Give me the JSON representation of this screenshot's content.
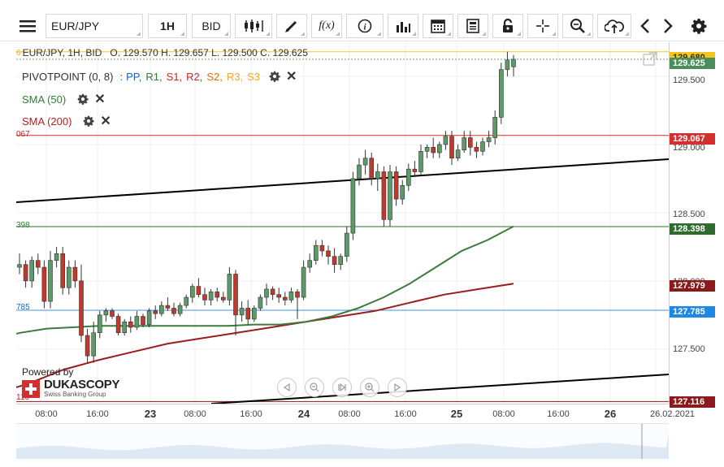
{
  "toolbar": {
    "symbol": "EUR/JPY",
    "period": "1H",
    "price_type": "BID",
    "icons": [
      "menu-icon",
      "candles-icon",
      "draw-icon",
      "function-icon",
      "info-icon",
      "volume-icon",
      "calendar-icon",
      "report-icon",
      "lock-icon",
      "crosshair-icon",
      "zoom-icon",
      "cloud-upload-icon",
      "arrow-left-icon",
      "arrow-right-icon",
      "gear-icon"
    ],
    "fx_label": "f(x)"
  },
  "header": {
    "ohlc": "EUR/JPY, 1H, BID   O. 129.570 H. 129.657 L. 129.500 C. 129.625",
    "left_digit": "6"
  },
  "legend": {
    "pivot": {
      "label": "PIVOTPOINT (0, 8)",
      "sep": ":",
      "items": [
        {
          "text": "PP,",
          "color": "#1565c0"
        },
        {
          "text": "R1,",
          "color": "#2e7d32"
        },
        {
          "text": "S1,",
          "color": "#c62828"
        },
        {
          "text": "R2,",
          "color": "#c62828"
        },
        {
          "text": "S2,",
          "color": "#ef6c00"
        },
        {
          "text": "R3,",
          "color": "#f9a825"
        },
        {
          "text": "S3",
          "color": "#f9a825"
        }
      ]
    },
    "sma50": {
      "label": "SMA (50)",
      "color": "#2e7d32"
    },
    "sma200": {
      "label": "SMA (200)",
      "color": "#b71c1c"
    }
  },
  "left_labels": [
    {
      "text": "067",
      "color": "#c62828"
    },
    {
      "text": "398",
      "color": "#2e7d32"
    },
    {
      "text": "785",
      "color": "#1565c0"
    },
    {
      "text": "116",
      "color": "#b71c1c"
    }
  ],
  "price_axis": {
    "labels": [
      "129.500",
      "129.000",
      "128.500",
      "128.000",
      "127.500"
    ],
    "tags": [
      {
        "text": "129.680",
        "bg": "#f5c518",
        "fg": "#333"
      },
      {
        "text": "129.625",
        "bg": "#4a8f5a",
        "fg": "#fff"
      },
      {
        "text": "129.067",
        "bg": "#d32f2f",
        "fg": "#fff"
      },
      {
        "text": "128.398",
        "bg": "#2e6b2e",
        "fg": "#fff"
      },
      {
        "text": "127.979",
        "bg": "#8b1a1a",
        "fg": "#fff"
      },
      {
        "text": "127.785",
        "bg": "#1e88e5",
        "fg": "#fff"
      },
      {
        "text": "127.116",
        "bg": "#8b1a1a",
        "fg": "#fff"
      }
    ]
  },
  "time_axis": {
    "labels": [
      {
        "text": "08:00",
        "day": false
      },
      {
        "text": "16:00",
        "day": false
      },
      {
        "text": "23",
        "day": true
      },
      {
        "text": "08:00",
        "day": false
      },
      {
        "text": "16:00",
        "day": false
      },
      {
        "text": "24",
        "day": true
      },
      {
        "text": "08:00",
        "day": false
      },
      {
        "text": "16:00",
        "day": false
      },
      {
        "text": "25",
        "day": true
      },
      {
        "text": "08:00",
        "day": false
      },
      {
        "text": "16:00",
        "day": false
      },
      {
        "text": "26",
        "day": true
      },
      {
        "text": "08:00",
        "day": false
      }
    ],
    "current_date": "26.02.2021"
  },
  "branding": {
    "powered_by": "Powered by",
    "name": "DUKASCOPY",
    "tagline": "Swiss Banking Group"
  },
  "chart_data": {
    "type": "candlestick",
    "symbol": "EUR/JPY",
    "timeframe": "1H",
    "ylim": [
      127.1,
      129.75
    ],
    "x_ticks": [
      "08:00",
      "16:00",
      "23",
      "08:00",
      "16:00",
      "24",
      "08:00",
      "16:00",
      "25",
      "08:00",
      "16:00",
      "26",
      "08:00"
    ],
    "candles": [
      [
        128.1,
        128.2,
        128.05,
        128.12
      ],
      [
        128.12,
        128.15,
        127.95,
        128.0
      ],
      [
        128.0,
        128.18,
        127.95,
        128.15
      ],
      [
        128.15,
        128.2,
        128.05,
        128.1
      ],
      [
        128.1,
        128.15,
        127.8,
        127.85
      ],
      [
        127.85,
        128.22,
        127.8,
        128.15
      ],
      [
        128.15,
        128.25,
        128.1,
        128.2
      ],
      [
        128.2,
        128.25,
        127.9,
        127.95
      ],
      [
        127.95,
        128.15,
        127.9,
        128.1
      ],
      [
        128.1,
        128.15,
        127.95,
        128.0
      ],
      [
        128.0,
        128.12,
        127.55,
        127.6
      ],
      [
        127.6,
        127.65,
        127.4,
        127.45
      ],
      [
        127.45,
        127.7,
        127.4,
        127.62
      ],
      [
        127.62,
        127.78,
        127.58,
        127.75
      ],
      [
        127.75,
        127.8,
        127.7,
        127.78
      ],
      [
        127.78,
        127.8,
        127.72,
        127.74
      ],
      [
        127.74,
        127.76,
        127.6,
        127.62
      ],
      [
        127.62,
        127.72,
        127.6,
        127.7
      ],
      [
        127.7,
        127.74,
        127.62,
        127.66
      ],
      [
        127.66,
        127.78,
        127.64,
        127.74
      ],
      [
        127.74,
        127.76,
        127.66,
        127.68
      ],
      [
        127.68,
        127.8,
        127.66,
        127.78
      ],
      [
        127.78,
        127.82,
        127.72,
        127.76
      ],
      [
        127.76,
        127.85,
        127.74,
        127.82
      ],
      [
        127.82,
        127.88,
        127.78,
        127.8
      ],
      [
        127.8,
        127.84,
        127.74,
        127.76
      ],
      [
        127.76,
        127.84,
        127.74,
        127.82
      ],
      [
        127.82,
        127.9,
        127.8,
        127.88
      ],
      [
        127.88,
        127.98,
        127.84,
        127.96
      ],
      [
        127.96,
        128.02,
        127.88,
        127.9
      ],
      [
        127.9,
        127.95,
        127.82,
        127.86
      ],
      [
        127.86,
        127.94,
        127.82,
        127.92
      ],
      [
        127.92,
        127.95,
        127.85,
        127.88
      ],
      [
        127.88,
        127.92,
        127.84,
        127.86
      ],
      [
        127.86,
        128.1,
        127.82,
        128.05
      ],
      [
        128.05,
        128.08,
        127.6,
        127.75
      ],
      [
        127.75,
        127.85,
        127.7,
        127.8
      ],
      [
        127.8,
        127.86,
        127.68,
        127.72
      ],
      [
        127.72,
        127.82,
        127.7,
        127.8
      ],
      [
        127.8,
        127.9,
        127.78,
        127.88
      ],
      [
        127.88,
        127.98,
        127.82,
        127.94
      ],
      [
        127.94,
        127.96,
        127.86,
        127.9
      ],
      [
        127.9,
        127.95,
        127.84,
        127.88
      ],
      [
        127.88,
        127.92,
        127.82,
        127.86
      ],
      [
        127.86,
        127.95,
        127.84,
        127.92
      ],
      [
        127.92,
        127.94,
        127.72,
        127.88
      ],
      [
        127.88,
        128.15,
        127.86,
        128.1
      ],
      [
        128.1,
        128.2,
        128.06,
        128.15
      ],
      [
        128.15,
        128.3,
        128.12,
        128.26
      ],
      [
        128.26,
        128.3,
        128.18,
        128.22
      ],
      [
        128.22,
        128.26,
        128.12,
        128.18
      ],
      [
        128.18,
        128.24,
        128.06,
        128.12
      ],
      [
        128.12,
        128.2,
        128.08,
        128.18
      ],
      [
        128.18,
        128.4,
        128.14,
        128.35
      ],
      [
        128.35,
        128.8,
        128.3,
        128.75
      ],
      [
        128.75,
        128.9,
        128.7,
        128.85
      ],
      [
        128.85,
        128.96,
        128.78,
        128.9
      ],
      [
        128.9,
        128.94,
        128.7,
        128.75
      ],
      [
        128.75,
        128.86,
        128.66,
        128.8
      ],
      [
        128.8,
        128.84,
        128.4,
        128.45
      ],
      [
        128.45,
        128.85,
        128.4,
        128.8
      ],
      [
        128.8,
        128.84,
        128.55,
        128.6
      ],
      [
        128.6,
        128.74,
        128.56,
        128.7
      ],
      [
        128.7,
        128.86,
        128.66,
        128.82
      ],
      [
        128.82,
        128.88,
        128.76,
        128.8
      ],
      [
        128.8,
        129.0,
        128.78,
        128.95
      ],
      [
        128.95,
        129.0,
        128.9,
        128.98
      ],
      [
        128.98,
        129.05,
        128.9,
        128.94
      ],
      [
        128.94,
        129.02,
        128.9,
        129.0
      ],
      [
        129.0,
        129.1,
        128.96,
        129.06
      ],
      [
        129.06,
        129.1,
        128.85,
        128.9
      ],
      [
        128.9,
        129.0,
        128.88,
        128.96
      ],
      [
        128.96,
        129.1,
        128.94,
        129.05
      ],
      [
        129.05,
        129.1,
        128.92,
        128.98
      ],
      [
        128.98,
        129.02,
        128.9,
        128.95
      ],
      [
        128.95,
        129.05,
        128.92,
        129.02
      ],
      [
        129.02,
        129.1,
        128.98,
        129.05
      ],
      [
        129.05,
        129.25,
        129.0,
        129.2
      ],
      [
        129.2,
        129.6,
        129.15,
        129.55
      ],
      [
        129.55,
        129.68,
        129.5,
        129.62
      ],
      [
        129.57,
        129.657,
        129.5,
        129.625
      ]
    ],
    "sma50": [
      127.58,
      127.62,
      127.65,
      127.66,
      127.67,
      127.67,
      127.67,
      127.67,
      127.67,
      127.67,
      127.68,
      127.68,
      127.7,
      127.74,
      127.8,
      127.88,
      127.98,
      128.1,
      128.22,
      128.3,
      128.4
    ],
    "sma200": [
      127.17,
      127.25,
      127.35,
      127.42,
      127.48,
      127.54,
      127.58,
      127.62,
      127.66,
      127.7,
      127.74,
      127.78,
      127.84,
      127.9,
      127.94,
      127.98
    ],
    "pivot_levels": {
      "R2": 129.68,
      "R1": 129.067,
      "PP": 128.398,
      "S1": 127.785,
      "S2": 127.116
    },
    "current": 129.625,
    "sma50_value": 128.398,
    "sma200_value": 127.979
  }
}
